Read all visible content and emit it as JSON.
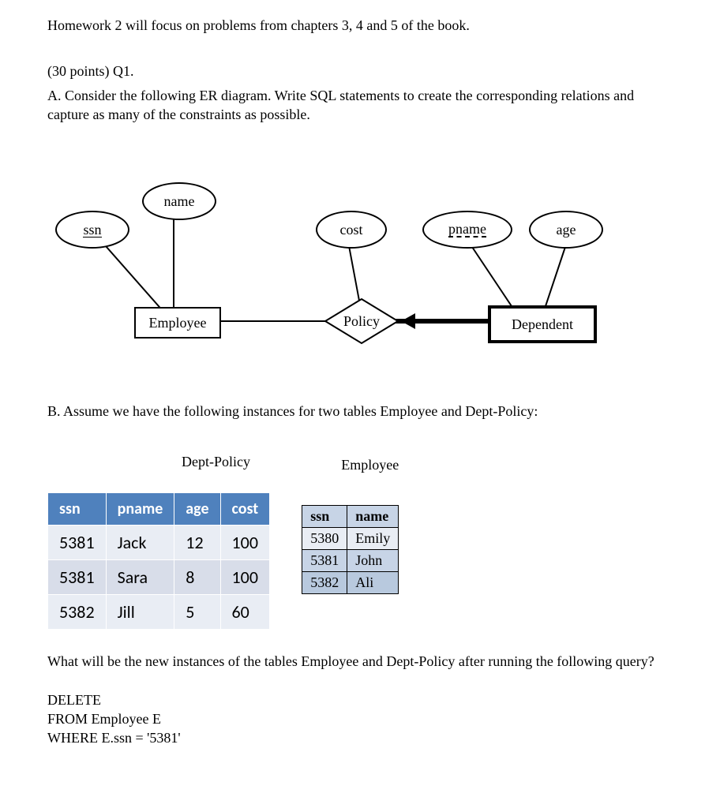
{
  "intro": "Homework 2 will focus on problems from chapters 3, 4 and 5 of the book.",
  "q1_header": "(30 points) Q1.",
  "partA": "A. Consider the following ER diagram. Write SQL statements to create the corresponding relations and capture as many of the constraints as possible.",
  "er": {
    "ssn": "ssn",
    "name": "name",
    "cost": "cost",
    "pname": "pname",
    "age": "age",
    "employee": "Employee",
    "policy": "Policy",
    "dependent": "Dependent"
  },
  "partB": "B. Assume we have the following instances for two tables Employee and Dept-Policy:",
  "dept_title": "Dept-Policy",
  "emp_title": "Employee",
  "dept_headers": [
    "ssn",
    "pname",
    "age",
    "cost"
  ],
  "dept_rows": [
    {
      "c0": "5381",
      "c1": "Jack",
      "c2": "12",
      "c3": "100"
    },
    {
      "c0": "5381",
      "c1": "Sara",
      "c2": "8",
      "c3": "100"
    },
    {
      "c0": "5382",
      "c1": "Jill",
      "c2": "5",
      "c3": "60"
    }
  ],
  "emp_headers": [
    "ssn",
    "name"
  ],
  "emp_rows": [
    {
      "c0": "5380",
      "c1": "Emily"
    },
    {
      "c0": "5381",
      "c1": "John"
    },
    {
      "c0": "5382",
      "c1": "Ali"
    }
  ],
  "after_q": "What will be the new instances of the tables Employee and Dept-Policy after running the following query?",
  "sql": {
    "l1": "DELETE",
    "l2": "FROM Employee  E",
    "l3": "WHERE E.ssn = '5381'"
  }
}
